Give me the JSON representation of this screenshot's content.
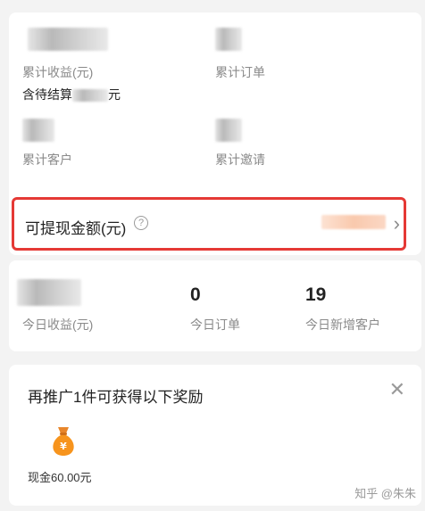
{
  "stats": {
    "total_earnings_label": "累计收益(元)",
    "pending_prefix": "含待结算",
    "pending_suffix": "元",
    "total_orders_label": "累计订单",
    "total_customers_label": "累计客户",
    "total_invites_label": "累计邀请"
  },
  "withdraw": {
    "title": "可提现金额(元)",
    "help_glyph": "?",
    "chevron_glyph": "›"
  },
  "today": {
    "earnings_label": "今日收益(元)",
    "orders_value": "0",
    "orders_label": "今日订单",
    "new_customers_value": "19",
    "new_customers_label": "今日新增客户"
  },
  "reward": {
    "title": "再推广1件可获得以下奖励",
    "close_glyph": "✕",
    "item_label": "现金60.00元",
    "icon": "money-bag-icon",
    "icon_color": "#f7941d"
  },
  "watermark": "知乎 @朱朱"
}
